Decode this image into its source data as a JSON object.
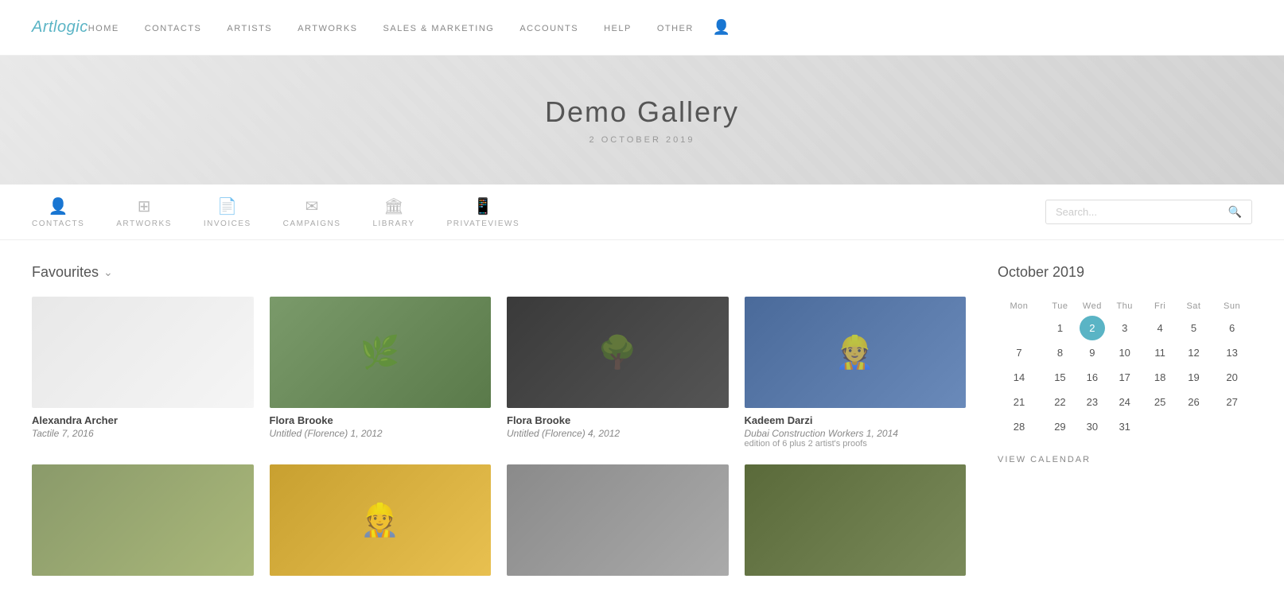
{
  "logo": {
    "text": "Artlogic"
  },
  "topnav": {
    "items": [
      {
        "label": "HOME",
        "id": "home"
      },
      {
        "label": "CONTACTS",
        "id": "contacts"
      },
      {
        "label": "ARTISTS",
        "id": "artists"
      },
      {
        "label": "ARTWORKS",
        "id": "artworks"
      },
      {
        "label": "SALES & MARKETING",
        "id": "sales"
      },
      {
        "label": "ACCOUNTS",
        "id": "accounts"
      },
      {
        "label": "HELP",
        "id": "help"
      },
      {
        "label": "OTHER",
        "id": "other"
      }
    ]
  },
  "hero": {
    "title": "Demo Gallery",
    "date": "2 OCTOBER 2019"
  },
  "subnav": {
    "items": [
      {
        "label": "CONTACTS",
        "icon": "👤",
        "id": "contacts"
      },
      {
        "label": "ARTWORKS",
        "icon": "⊞",
        "id": "artworks"
      },
      {
        "label": "INVOICES",
        "icon": "📄",
        "id": "invoices"
      },
      {
        "label": "CAMPAIGNS",
        "icon": "✉",
        "id": "campaigns"
      },
      {
        "label": "LIBRARY",
        "icon": "🏛",
        "id": "library"
      },
      {
        "label": "PRIVATEVIEWS",
        "icon": "📱",
        "id": "privateviews"
      }
    ],
    "search": {
      "placeholder": "Search..."
    }
  },
  "favourites": {
    "title": "Favourites",
    "artworks": [
      {
        "artist": "Alexandra Archer",
        "title": "Tactile 7",
        "year": "2016",
        "imgClass": "img-white"
      },
      {
        "artist": "Flora Brooke",
        "title": "Untitled (Florence) 1",
        "year": "2012",
        "imgClass": "img-green"
      },
      {
        "artist": "Flora Brooke",
        "title": "Untitled (Florence) 4",
        "year": "2012",
        "imgClass": "img-dark"
      },
      {
        "artist": "Kadeem Darzi",
        "title": "Dubai Construction Workers 1",
        "year": "2014",
        "edition": "edition of 6 plus 2 artist's proofs",
        "imgClass": "img-blue"
      }
    ],
    "artworks2": [
      {
        "artist": "",
        "title": "",
        "year": "",
        "imgClass": "img-road"
      },
      {
        "artist": "",
        "title": "",
        "year": "",
        "imgClass": "img-yellow"
      },
      {
        "artist": "",
        "title": "",
        "year": "",
        "imgClass": "img-crowd"
      },
      {
        "artist": "",
        "title": "",
        "year": "",
        "imgClass": "img-painting"
      }
    ]
  },
  "calendar": {
    "title": "October 2019",
    "days_header": [
      "Mon",
      "Tue",
      "Wed",
      "Thu",
      "Fri",
      "Sat",
      "Sun"
    ],
    "weeks": [
      [
        "",
        "1",
        "2",
        "3",
        "4",
        "5",
        "6"
      ],
      [
        "7",
        "8",
        "9",
        "10",
        "11",
        "12",
        "13"
      ],
      [
        "14",
        "15",
        "16",
        "17",
        "18",
        "19",
        "20"
      ],
      [
        "21",
        "22",
        "23",
        "24",
        "25",
        "26",
        "27"
      ],
      [
        "28",
        "29",
        "30",
        "31",
        "",
        "",
        ""
      ]
    ],
    "today": "2",
    "view_calendar_label": "VIEW CALENDAR"
  }
}
